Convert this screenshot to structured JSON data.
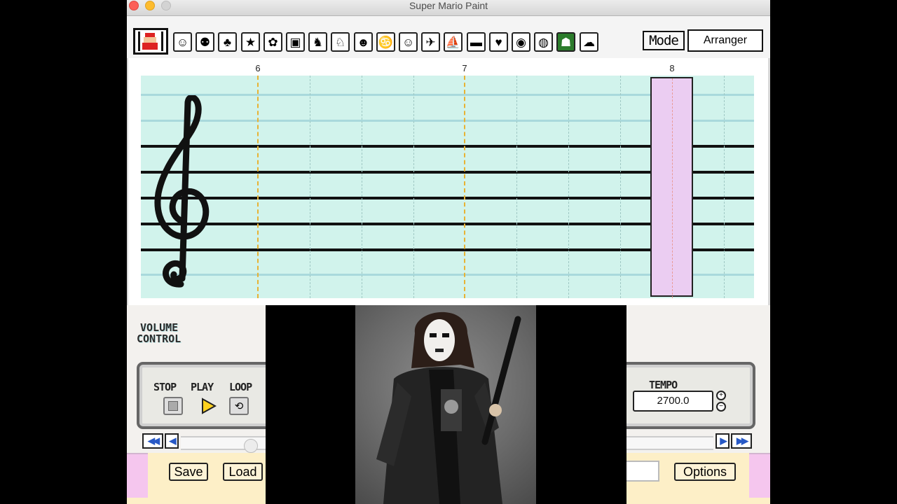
{
  "window": {
    "title": "Super Mario Paint"
  },
  "toolbar": {
    "instruments": [
      {
        "icon": "mario-icon",
        "glyph": "☺"
      },
      {
        "icon": "mushroom-icon",
        "glyph": "⚉"
      },
      {
        "icon": "yoshi-icon",
        "glyph": "♣"
      },
      {
        "icon": "star-icon",
        "glyph": "★"
      },
      {
        "icon": "flower-icon",
        "glyph": "✿"
      },
      {
        "icon": "gameboy-icon",
        "glyph": "▣"
      },
      {
        "icon": "dog-icon",
        "glyph": "♞"
      },
      {
        "icon": "cat-icon",
        "glyph": "♘"
      },
      {
        "icon": "pig-icon",
        "glyph": "☻"
      },
      {
        "icon": "swan-icon",
        "glyph": "♋"
      },
      {
        "icon": "face-icon",
        "glyph": "☺"
      },
      {
        "icon": "plane-icon",
        "glyph": "✈"
      },
      {
        "icon": "boat-icon",
        "glyph": "⛵"
      },
      {
        "icon": "car-icon",
        "glyph": "▬"
      },
      {
        "icon": "heart-icon",
        "glyph": "♥"
      },
      {
        "icon": "piranha-icon",
        "glyph": "◉"
      },
      {
        "icon": "coin-icon",
        "glyph": "◍"
      },
      {
        "icon": "shyguy-icon",
        "glyph": "☗"
      },
      {
        "icon": "boo-icon",
        "glyph": "☁"
      }
    ],
    "selected_index": 17,
    "mode_label": "Mode",
    "mode_value": "Arranger"
  },
  "staff": {
    "measures": [
      "6",
      "7",
      "8"
    ]
  },
  "volume": {
    "line1": "VOLUME",
    "line2": "CONTROL"
  },
  "transport": {
    "stop_label": "STOP",
    "play_label": "PLAY",
    "loop_label": "LOOP",
    "tempo_label": "TEMPO",
    "tempo_value": "2700.0",
    "tempo_up": "+",
    "tempo_down": "−"
  },
  "bottom": {
    "save_label": "Save",
    "load_label": "Load",
    "options_label": "Options"
  },
  "colors": {
    "staff_bg": "#d1f3ec",
    "cursor": "#ebcdf2",
    "measure_line": "#e8b233",
    "bottom_bar": "#fdefc7",
    "pink": "#f5c6ee"
  }
}
